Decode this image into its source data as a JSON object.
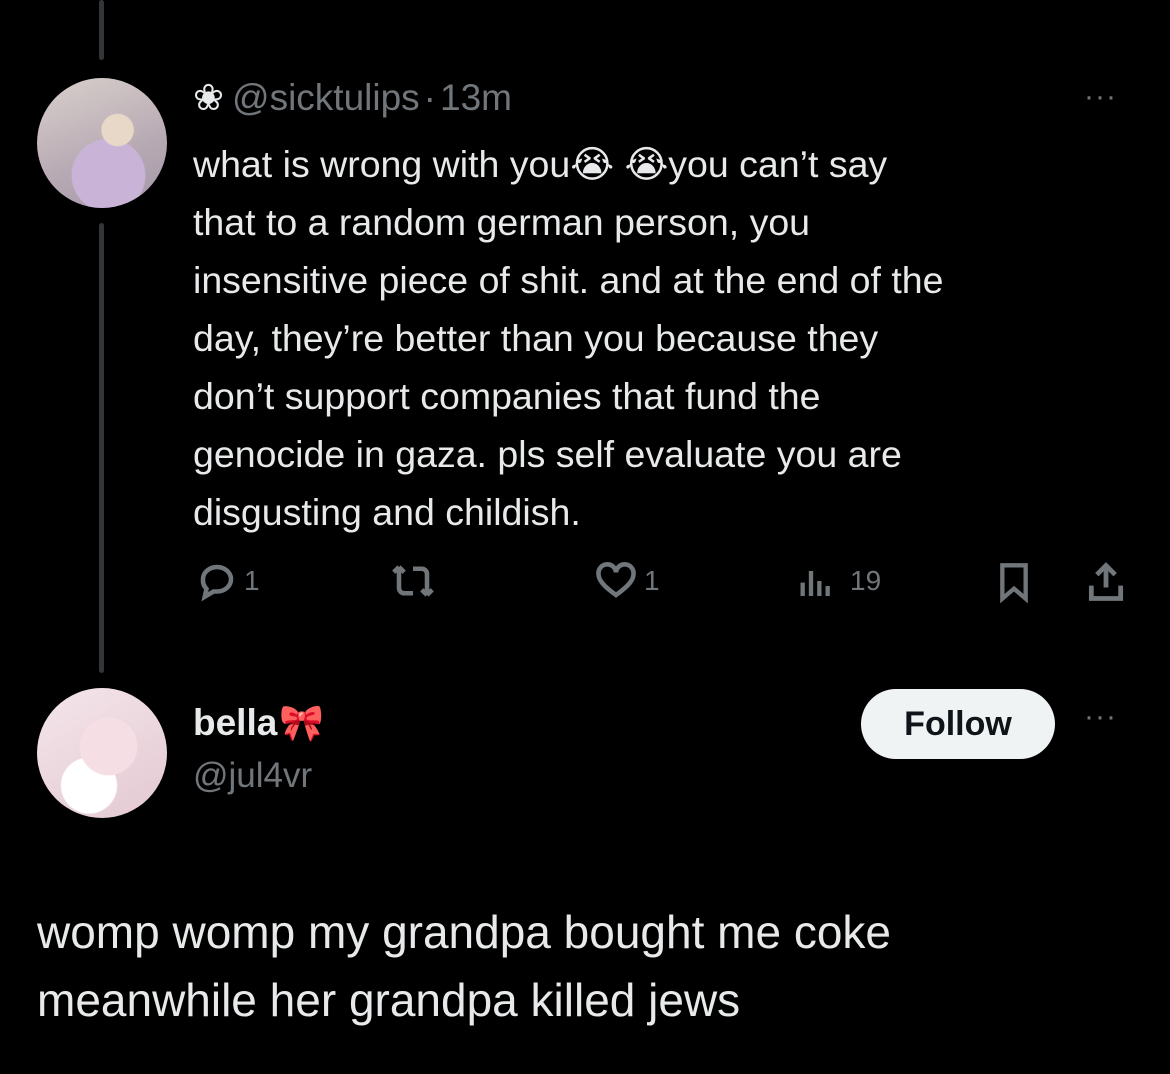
{
  "tweet1": {
    "flower_glyph": "❀",
    "handle": "@sicktulips",
    "separator": "·",
    "time": "13m",
    "more": "···",
    "lines": [
      "what is wrong with you😭 😭you can’t say",
      "that to a random german person, you",
      "insensitive piece of shit. and at the end of the",
      "day, they’re better than you because they",
      "don’t support companies that fund the",
      "genocide in gaza. pls self evaluate you are",
      "disgusting and childish."
    ],
    "replies": "1",
    "likes": "1",
    "views": "19",
    "icons": {
      "reply": "reply-icon",
      "retweet": "retweet-icon",
      "like": "heart-icon",
      "views": "views-icon",
      "bookmark": "bookmark-icon",
      "share": "share-icon"
    }
  },
  "tweet2": {
    "name": "bella",
    "name_emoji": "🎀",
    "handle": "@jul4vr",
    "follow_label": "Follow",
    "more": "···",
    "lines": [
      "womp womp my grandpa bought me coke",
      "meanwhile her grandpa killed jews"
    ]
  },
  "colors": {
    "background": "#000000",
    "text": "#e7e9ea",
    "muted": "#71767b",
    "follow_bg": "#eff3f4"
  }
}
